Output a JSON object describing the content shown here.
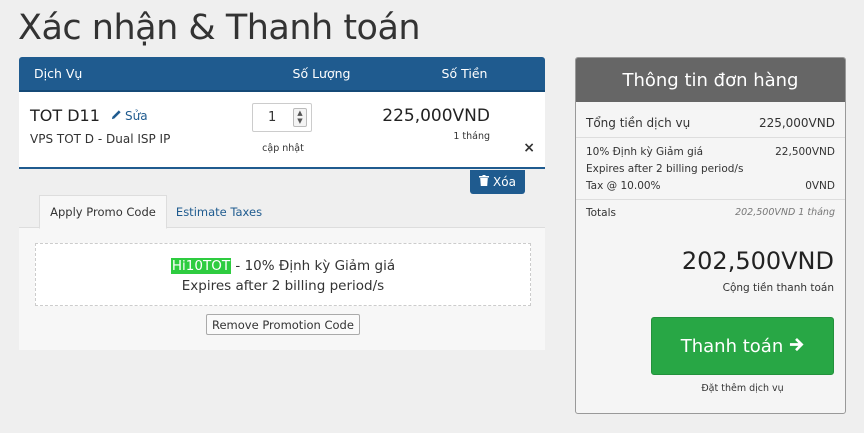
{
  "page": {
    "title": "Xác nhận & Thanh toán"
  },
  "cart": {
    "headers": {
      "service": "Dịch Vụ",
      "quantity": "Số Lượng",
      "price": "Số Tiền"
    },
    "item": {
      "name": "TOT D11",
      "edit_label": "Sửa",
      "description": "VPS TOT D - Dual ISP IP",
      "quantity": "1",
      "update_label": "cập nhật",
      "price": "225,000VND",
      "cycle": "1 tháng",
      "remove_symbol": "×"
    },
    "delete_label": "Xóa"
  },
  "promo": {
    "tabs": [
      {
        "label": "Apply Promo Code"
      },
      {
        "label": "Estimate Taxes"
      }
    ],
    "code": "Hi10TOT",
    "description": " - 10% Định kỳ Giảm giá",
    "expires": "Expires after 2 billing period/s",
    "remove_label": "Remove Promotion Code"
  },
  "summary": {
    "title": "Thông tin đơn hàng",
    "subtotal_label": "Tổng tiền dịch vụ",
    "subtotal_value": "225,000VND",
    "discount_label": "10% Định kỳ Giảm giá",
    "discount_value": "22,500VND",
    "discount_expires": "Expires after 2 billing period/s",
    "tax_label": "Tax @ 10.00%",
    "tax_value": "0VND",
    "totals_label": "Totals",
    "totals_value": "202,500VND 1 tháng",
    "grand_total": "202,500VND",
    "grand_caption": "Cộng tiền thanh toán",
    "checkout_label": "Thanh toán",
    "continue_label": "Đặt thêm dịch vụ"
  },
  "colors": {
    "header_blue": "#1f5b8f",
    "checkout_green": "#28a745",
    "promo_highlight": "#2ecc40",
    "summary_head": "#666666"
  },
  "icons": {
    "edit": "pencil-icon",
    "delete": "trash-icon",
    "checkout": "arrow-right-icon"
  }
}
